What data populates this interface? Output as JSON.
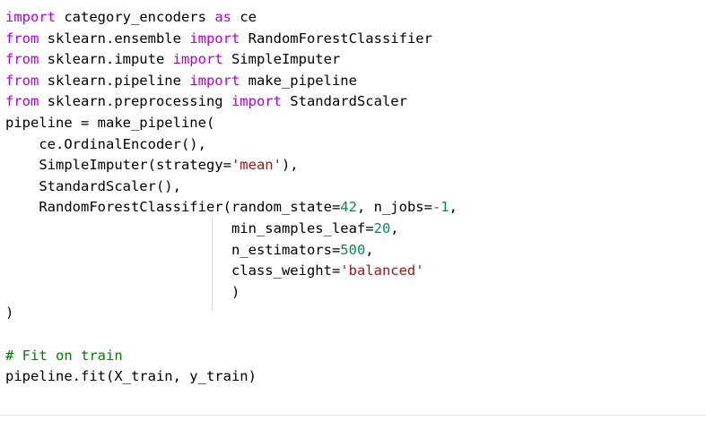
{
  "colors": {
    "keyword": "#af00db",
    "text": "#000000",
    "string": "#a31515",
    "number": "#098658",
    "comment": "#008000",
    "indent_guide": "#d9d9d9",
    "background": "#ffffff"
  },
  "code_lines": [
    [
      {
        "t": "import",
        "k": "keyword"
      },
      {
        "t": " category_encoders ",
        "k": "text"
      },
      {
        "t": "as",
        "k": "keyword"
      },
      {
        "t": " ce",
        "k": "text"
      }
    ],
    [
      {
        "t": "from",
        "k": "keyword"
      },
      {
        "t": " sklearn.ensemble ",
        "k": "text"
      },
      {
        "t": "import",
        "k": "keyword"
      },
      {
        "t": " RandomForestClassifier",
        "k": "text"
      }
    ],
    [
      {
        "t": "from",
        "k": "keyword"
      },
      {
        "t": " sklearn.impute ",
        "k": "text"
      },
      {
        "t": "import",
        "k": "keyword"
      },
      {
        "t": " SimpleImputer",
        "k": "text"
      }
    ],
    [
      {
        "t": "from",
        "k": "keyword"
      },
      {
        "t": " sklearn.pipeline ",
        "k": "text"
      },
      {
        "t": "import",
        "k": "keyword"
      },
      {
        "t": " make_pipeline",
        "k": "text"
      }
    ],
    [
      {
        "t": "from",
        "k": "keyword"
      },
      {
        "t": " sklearn.preprocessing ",
        "k": "text"
      },
      {
        "t": "import",
        "k": "keyword"
      },
      {
        "t": " StandardScaler",
        "k": "text"
      }
    ],
    [
      {
        "t": "pipeline = make_pipeline(",
        "k": "text"
      }
    ],
    [
      {
        "t": "    ce.OrdinalEncoder(),",
        "k": "text"
      }
    ],
    [
      {
        "t": "    SimpleImputer(strategy=",
        "k": "text"
      },
      {
        "t": "'mean'",
        "k": "string"
      },
      {
        "t": "),",
        "k": "text"
      }
    ],
    [
      {
        "t": "    StandardScaler(),",
        "k": "text"
      }
    ],
    [
      {
        "t": "    RandomForestClassifier(random_state=",
        "k": "text"
      },
      {
        "t": "42",
        "k": "number"
      },
      {
        "t": ", n_jobs=",
        "k": "text"
      },
      {
        "t": "-1",
        "k": "number"
      },
      {
        "t": ",",
        "k": "text"
      }
    ],
    [
      {
        "t": "                           min_samples_leaf=",
        "k": "text"
      },
      {
        "t": "20",
        "k": "number"
      },
      {
        "t": ",",
        "k": "text"
      }
    ],
    [
      {
        "t": "                           n_estimators=",
        "k": "text"
      },
      {
        "t": "500",
        "k": "number"
      },
      {
        "t": ",",
        "k": "text"
      }
    ],
    [
      {
        "t": "                           class_weight=",
        "k": "text"
      },
      {
        "t": "'balanced'",
        "k": "string"
      }
    ],
    [
      {
        "t": "                           )",
        "k": "text"
      }
    ],
    [
      {
        "t": ")",
        "k": "text"
      }
    ],
    [
      {
        "t": "",
        "k": "text"
      }
    ],
    [
      {
        "t": "# Fit on train",
        "k": "comment"
      }
    ],
    [
      {
        "t": "pipeline.fit(X_train, y_train)",
        "k": "text"
      }
    ]
  ]
}
